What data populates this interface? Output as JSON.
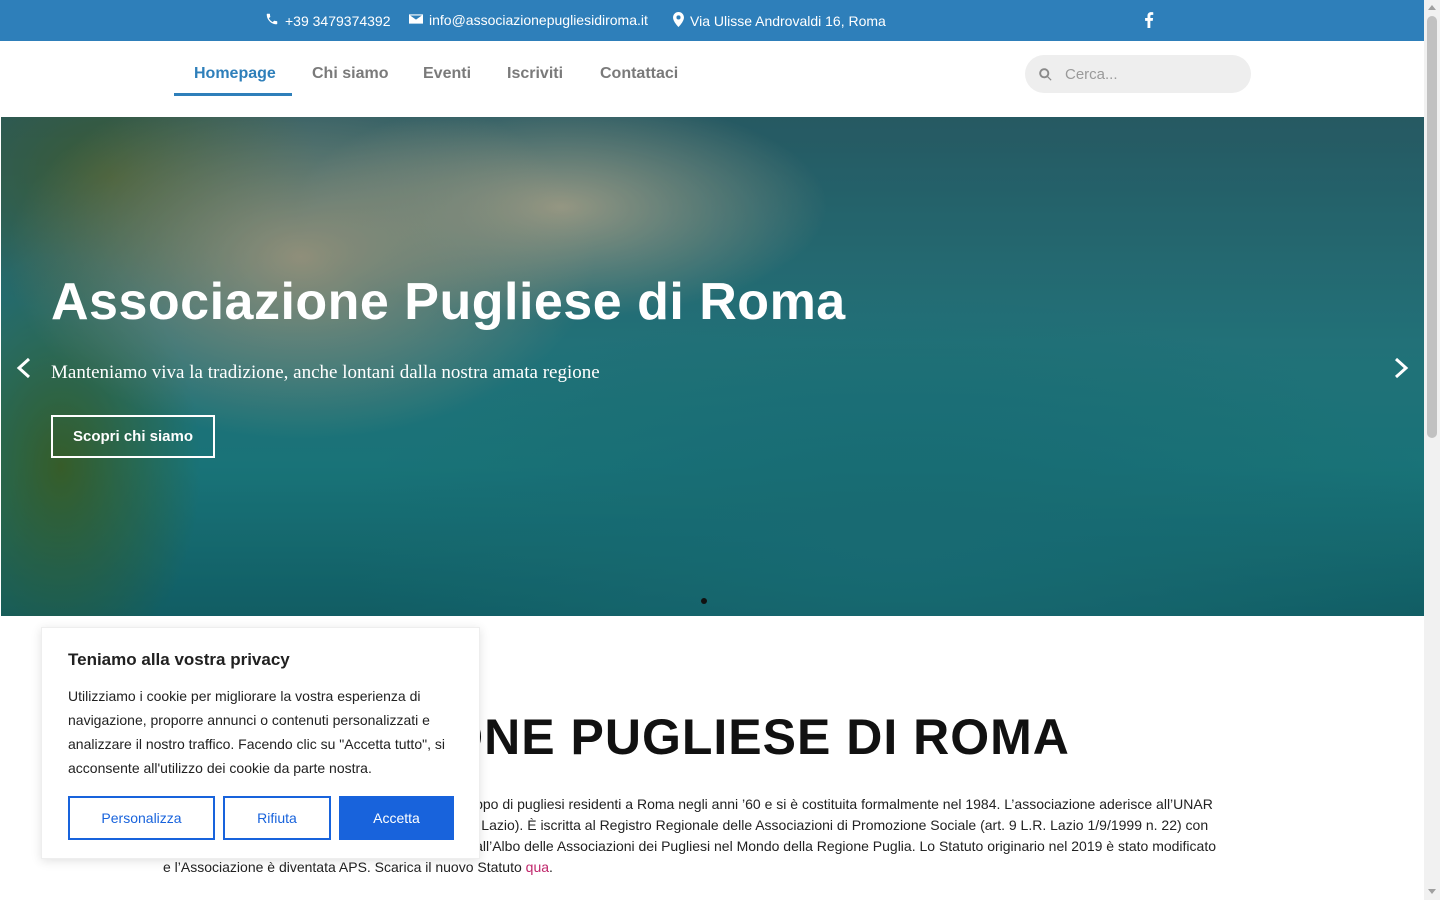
{
  "topbar": {
    "phone": "+39 3479374392",
    "email": "info@associazionepugliesidiroma.it",
    "address": "Via Ulisse Androvaldi 16, Roma",
    "bg_color": "#2e7fba"
  },
  "nav": {
    "items": [
      {
        "label": "Homepage",
        "active": true
      },
      {
        "label": "Chi siamo"
      },
      {
        "label": "Eventi"
      },
      {
        "label": "Iscriviti"
      },
      {
        "label": "Contattaci"
      }
    ],
    "search_placeholder": "Cerca...",
    "accent_color": "#2e7fba"
  },
  "hero": {
    "title": "Associazione Pugliese di Roma",
    "subtitle": "Manteniamo viva la tradizione, anche lontani dalla nostra amata regione",
    "button": "Scopri chi siamo"
  },
  "content": {
    "title": "ASSOCIAZIONE PUGLIESE DI ROMA",
    "line1": "L’Associazione Pugliese di Roma è nata da un gruppo di pugliesi residenti a Roma negli anni ’60 e si è costituita formalmente nel 1984. L’associazione aderisce all’UNAR",
    "line2": "(Unione Nazionale delle Associazioni Regionali del Lazio). È iscritta al Registro Regionale delle Associazioni di Promozione Sociale (art. 9 L.R. Lazio 1/9/1999 n. 22) con",
    "line3": "determinazione n. B4003 del 28/10/2009 e iscritta all’Albo delle Associazioni dei Pugliesi nel Mondo della Regione Puglia. Lo Statuto originario nel 2019 è stato modificato",
    "line4": "e l’Associazione è diventata APS. Scarica il nuovo Statuto ",
    "link": "qua",
    "end": "."
  },
  "cookie": {
    "title": "Teniamo alla vostra privacy",
    "text": "Utilizziamo i cookie per migliorare la vostra esperienza di navigazione, proporre annunci o contenuti personalizzati e analizzare il nostro traffico. Facendo clic su \"Accetta tutto\", si acconsente all'utilizzo dei cookie da parte nostra.",
    "customize": "Personalizza",
    "reject": "Rifiuta",
    "accept": "Accetta",
    "button_color": "#1863dc"
  }
}
